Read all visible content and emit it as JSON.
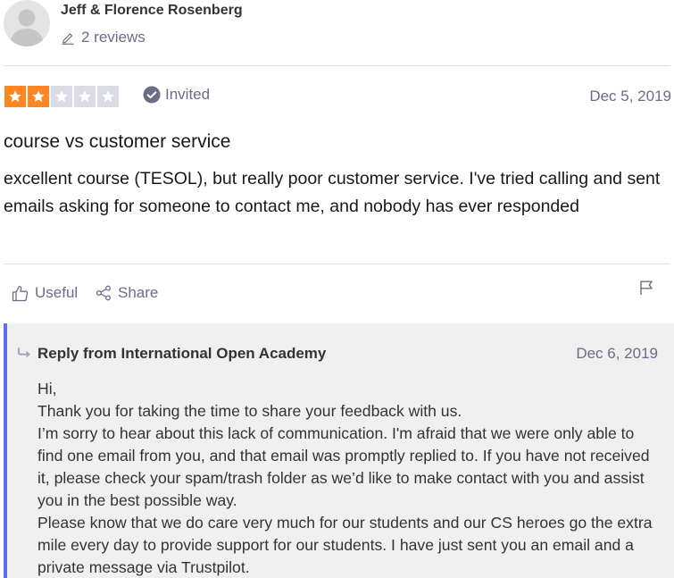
{
  "consumer": {
    "name": "Jeff & Florence Rosenberg",
    "reviews_count": "2 reviews"
  },
  "review": {
    "rating": 2,
    "rating_max": 5,
    "star_colors": {
      "filled": "#ff8622",
      "empty": "#dcdce6"
    },
    "invited_label": "Invited",
    "date": "Dec 5, 2019",
    "title": "course vs customer service",
    "body": "excellent course (TESOL), but really poor customer service. I've tried calling and sent emails asking for someone to contact me, and nobody has ever responded"
  },
  "actions": {
    "useful_label": "Useful",
    "share_label": "Share"
  },
  "reply": {
    "heading": "Reply from International Open Academy",
    "date": "Dec 6, 2019",
    "accent_color": "#5f6ee8",
    "lines": [
      "Hi,",
      "Thank you for taking the time to share your feedback with us.",
      "I’m sorry to hear about this lack of communication. I'm afraid that we were only able to find one email from you, and that email was promptly replied to. If you have not received it, please check your spam/trash folder as we’d like to make contact with you and assist you in the best possible way.",
      "Please know that we do care very much for our students and our CS heroes go the extra mile every day to provide support for our students. I have just sent you an email and a private message via Trustpilot."
    ]
  }
}
